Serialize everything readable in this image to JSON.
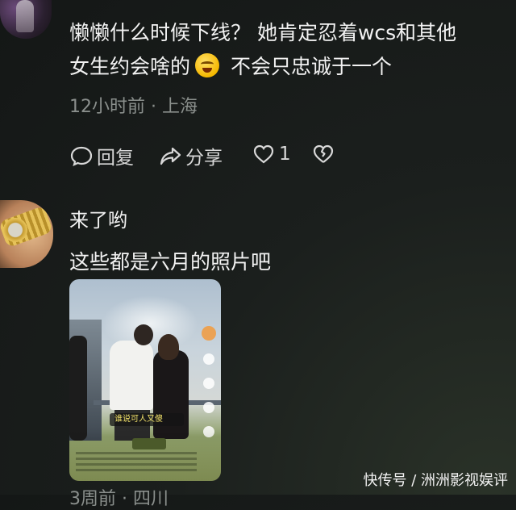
{
  "comment1": {
    "line1": "懒懒什么时候下线？ 她肯定忍着wcs和其他",
    "line2_before_emoji": "女生约会啥的",
    "line2_after_emoji": "不会只忠诚于一个",
    "emoji": "laughing-crying-emoji",
    "meta": "12小时前 · 上海",
    "reply_label": "回复",
    "share_label": "分享",
    "like_count": "1"
  },
  "comment2": {
    "username": "来了哟",
    "text": "这些都是六月的照片吧",
    "thumb_caption": "谁说可人又傻",
    "meta_partial": "3周前 · 四川"
  },
  "watermark": "快传号 / 洲洲影视娱评"
}
